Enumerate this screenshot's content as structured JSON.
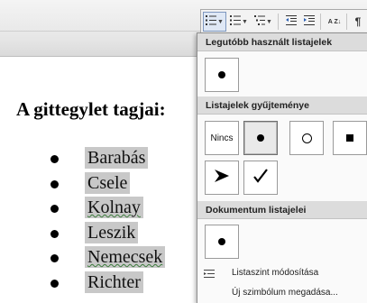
{
  "toolbar": {
    "buttons": [
      {
        "icon": "bullet-list-icon",
        "active": true
      },
      {
        "icon": "numbered-list-icon"
      },
      {
        "icon": "multilevel-list-icon"
      },
      {
        "icon": "decrease-indent-icon"
      },
      {
        "icon": "increase-indent-icon"
      },
      {
        "icon": "sort-icon",
        "label": "A Z"
      },
      {
        "icon": "pilcrow-icon",
        "label": "¶"
      }
    ]
  },
  "document": {
    "heading": "A gittegylet tagjai:",
    "items": [
      "Barabás",
      "Csele",
      "Kolnay",
      "Leszik",
      "Nemecsek",
      "Richter"
    ]
  },
  "menu": {
    "recent_header": "Legutóbb használt listajelek",
    "library_header": "Listajelek gyűjteménye",
    "document_header": "Dokumentum listajelei",
    "none_label": "Nincs",
    "library_items": [
      "none",
      "filled-circle",
      "hollow-circle",
      "filled-square",
      "arrowhead",
      "checkmark"
    ],
    "change_level": "Listaszint módosítása",
    "define_new": "Új szimbólum megadása..."
  }
}
